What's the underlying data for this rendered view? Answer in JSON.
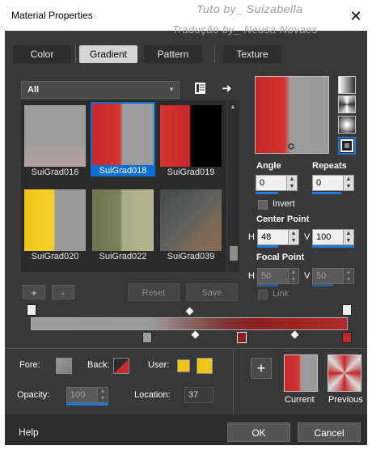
{
  "window": {
    "title": "Material Properties",
    "watermark_line1": "Tuto by_ Suizabella",
    "watermark_line2": "Tradução by_ Neusa Novaes"
  },
  "tabs": [
    {
      "label": "Color",
      "active": false
    },
    {
      "label": "Gradient",
      "active": true
    },
    {
      "label": "Pattern",
      "active": false
    },
    {
      "label": "Texture",
      "active": false
    }
  ],
  "filter": {
    "selected": "All"
  },
  "gallery": [
    {
      "name": "SuiGrad016",
      "selected": false
    },
    {
      "name": "SuiGrad018",
      "selected": true
    },
    {
      "name": "SuiGrad019",
      "selected": false
    },
    {
      "name": "SuiGrad020",
      "selected": false
    },
    {
      "name": "SuiGrad022",
      "selected": false
    },
    {
      "name": "SuiGrad039",
      "selected": false
    }
  ],
  "gallery_buttons": {
    "add": "+",
    "remove": "-",
    "reset": "Reset",
    "save": "Save"
  },
  "params": {
    "angle_label": "Angle",
    "angle_value": "0",
    "repeats_label": "Repeats",
    "repeats_value": "0",
    "invert_label": "Invert",
    "center_label": "Center Point",
    "center_h": "48",
    "center_v": "100",
    "focal_label": "Focal Point",
    "focal_h": "50",
    "focal_v": "50",
    "link_label": "Link",
    "h_letter": "H",
    "v_letter": "V"
  },
  "bottom": {
    "fore_label": "Fore:",
    "back_label": "Back:",
    "user_label": "User:",
    "opacity_label": "Opacity:",
    "opacity_value": "100",
    "location_label": "Location:",
    "location_value": "37",
    "add_button": "+",
    "current_label": "Current",
    "previous_label": "Previous"
  },
  "footer": {
    "help": "Help",
    "ok": "OK",
    "cancel": "Cancel"
  },
  "colors": {
    "accent": "#0d6fd3",
    "gradient_red": "#c4282a",
    "gradient_gray": "#9c9c9c",
    "user_yellow": "#f0c419"
  }
}
